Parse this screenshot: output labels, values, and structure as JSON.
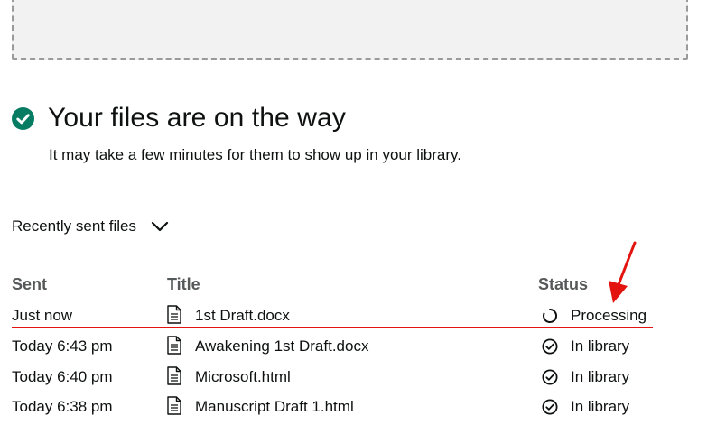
{
  "header": {
    "title": "Your files are on the way",
    "subtitle": "It may take a few minutes for them to show up in your library.",
    "success_color": "#067d62"
  },
  "recent": {
    "label": "Recently sent files"
  },
  "table": {
    "columns": {
      "sent": "Sent",
      "title": "Title",
      "status": "Status"
    },
    "rows": [
      {
        "sent": "Just now",
        "title": "1st Draft.docx",
        "status": "Processing",
        "status_icon": "spinner-icon"
      },
      {
        "sent": "Today 6:43 pm",
        "title": "Awakening 1st Draft.docx",
        "status": "In library",
        "status_icon": "check-circle-icon"
      },
      {
        "sent": "Today 6:40 pm",
        "title": "Microsoft.html",
        "status": "In library",
        "status_icon": "check-circle-icon"
      },
      {
        "sent": "Today 6:38 pm",
        "title": "Manuscript Draft 1.html",
        "status": "In library",
        "status_icon": "check-circle-icon"
      }
    ]
  },
  "annotation_color": "#e3140f"
}
